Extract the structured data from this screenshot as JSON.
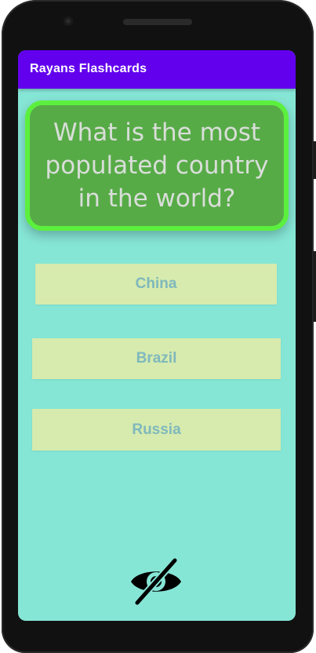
{
  "app": {
    "title": "Rayans Flashcards"
  },
  "question": {
    "text": "What is the most populated country in the world?"
  },
  "answers": [
    {
      "label": "China"
    },
    {
      "label": "Brazil"
    },
    {
      "label": "Russia"
    }
  ],
  "toggle": {
    "icon": "eye-off-icon"
  },
  "colors": {
    "appbar": "#6200ee",
    "screen_bg": "#86e6d6",
    "card_fill": "#57ab47",
    "card_border": "#5cf03e",
    "answer_bg": "#d6ebad",
    "answer_text": "#7fb8bd"
  }
}
